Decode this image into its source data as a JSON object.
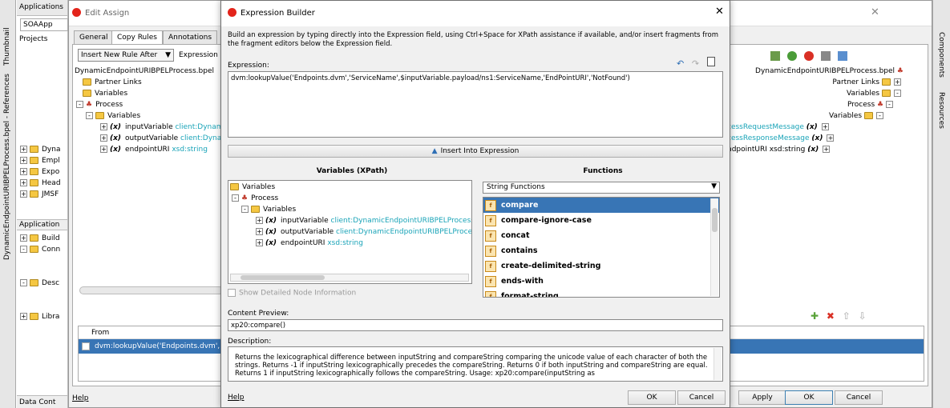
{
  "outer": {
    "left_vtabs": [
      "Thumbnail",
      "DynamicEndpointURIBPELProcess.bpel - References"
    ],
    "right_vtabs": [
      "Components",
      "Resources"
    ],
    "applications_label": "Applications",
    "soa_label": "SOAApp",
    "projects_label": "Projects",
    "project_items": [
      "Dyna",
      "Empl",
      "Expo",
      "Head",
      "JMSF"
    ],
    "application_label": "Application",
    "app_items": [
      "Build",
      "Conn",
      "Desc",
      "Libra"
    ],
    "data_control_label": "Data Cont",
    "right_panel_text": "nks"
  },
  "edit_assign": {
    "title": "Edit Assign",
    "tabs": [
      "General",
      "Copy Rules",
      "Annotations"
    ],
    "insert_rule": "Insert New Rule After",
    "expression_label": "Expression La",
    "left_tree": {
      "root": "DynamicEndpointURIBPELProcess.bpel",
      "partner_links": "Partner Links",
      "variables": "Variables",
      "process": "Process",
      "process_variables": "Variables",
      "vars": [
        {
          "name": "inputVariable",
          "type": "client:Dynami"
        },
        {
          "name": "outputVariable",
          "type": "client:Dynar"
        },
        {
          "name": "endpointURI",
          "type": "xsd:string"
        }
      ]
    },
    "right_tree": {
      "root": "DynamicEndpointURIBPELProcess.bpel",
      "partner_links": "Partner Links",
      "variables": "Variables",
      "process": "Process",
      "process_variables": "Variables",
      "vars": [
        "cessRequestMessage",
        "cessResponseMessage",
        "ndpointURI xsd:string"
      ]
    },
    "from_header": "From",
    "from_value": "dvm:lookupValue('Endpoints.dvm',",
    "help": "Help",
    "apply": "Apply",
    "ok": "OK",
    "cancel": "Cancel"
  },
  "dialog": {
    "title": "Expression Builder",
    "intro": "Build an expression by typing directly into the Expression field, using Ctrl+Space for XPath assistance if available, and/or insert fragments from the fragment editors below the Expression field.",
    "expression_label": "Expression:",
    "expression_value": "dvm:lookupValue('Endpoints.dvm','ServiceName',$inputVariable.payload/ns1:ServiceName,'EndPointURI','NotFound')",
    "insert_button": "Insert Into Expression",
    "variables_heading": "Variables (XPath)",
    "functions_heading": "Functions",
    "var_tree": {
      "variables": "Variables",
      "process": "Process",
      "process_variables": "Variables",
      "vars": [
        {
          "name": "inputVariable",
          "type": "client:DynamicEndpointURIBPELProcessRe"
        },
        {
          "name": "outputVariable",
          "type": "client:DynamicEndpointURIBPELProcessR"
        },
        {
          "name": "endpointURI",
          "type": "xsd:string"
        }
      ]
    },
    "show_detailed": "Show Detailed Node Information",
    "function_category": "String Functions",
    "functions": [
      "compare",
      "compare-ignore-case",
      "concat",
      "contains",
      "create-delimited-string",
      "ends-with",
      "format-string"
    ],
    "selected_function": "compare",
    "content_preview_label": "Content Preview:",
    "content_preview_value": "xp20:compare()",
    "description_label": "Description:",
    "description_text": "Returns the lexicographical difference between inputString and compareString comparing the unicode value of each character of both the strings. Returns -1 if inputString lexicographically precedes the compareString. Returns 0 if both inputString and compareString are equal. Returns 1 if inputString lexicographically follows the compareString. Usage: xp20:compare(inputString as",
    "help": "Help",
    "ok": "OK",
    "cancel": "Cancel"
  },
  "colors": {
    "selection": "#3875b5",
    "accent_blue": "#1f5fa8",
    "cyan_type": "#1aa4b8",
    "dialog_bg": "#f0f0f0"
  }
}
